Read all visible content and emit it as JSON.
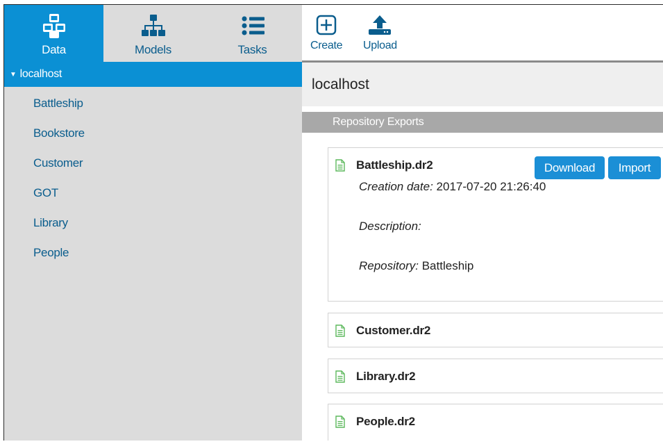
{
  "nav": {
    "data_label": "Data",
    "models_label": "Models",
    "tasks_label": "Tasks"
  },
  "sidebar": {
    "server": "localhost",
    "repositories": [
      "Battleship",
      "Bookstore",
      "Customer",
      "GOT",
      "Library",
      "People"
    ]
  },
  "toolbar": {
    "create_label": "Create",
    "upload_label": "Upload"
  },
  "main": {
    "server_title": "localhost",
    "section_title": "Repository Exports",
    "exports": [
      {
        "name": "Battleship.dr2",
        "download_label": "Download",
        "import_label": "Import",
        "creation_label": "Creation date:",
        "creation_value": "2017-07-20 21:26:40",
        "description_label": "Description:",
        "repository_label": "Repository:",
        "repository_value": "Battleship"
      },
      {
        "name": "Customer.dr2"
      },
      {
        "name": "Library.dr2"
      },
      {
        "name": "People.dr2"
      }
    ]
  },
  "colors": {
    "accent": "#0b90d4",
    "button": "#1b8fd6",
    "link_text": "#0a5d8d",
    "sidebar_bg": "#dcdcdc",
    "section_header": "#a8a8a8",
    "file_icon": "#5cb85c"
  },
  "icons": {
    "data": "cubes-icon",
    "models": "sitemap-icon",
    "tasks": "list-icon",
    "create": "plus-square-icon",
    "upload": "upload-icon",
    "file": "file-text-icon"
  }
}
